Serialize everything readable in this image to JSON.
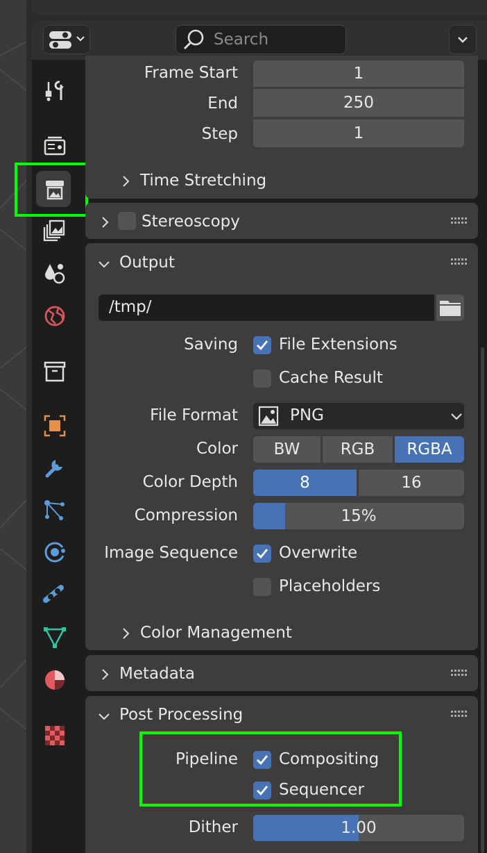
{
  "header": {
    "search_placeholder": "Search"
  },
  "frame_range": {
    "start_label": "Frame Start",
    "start_value": "1",
    "end_label": "End",
    "end_value": "250",
    "step_label": "Step",
    "step_value": "1",
    "time_stretching_label": "Time Stretching"
  },
  "stereoscopy": {
    "label": "Stereoscopy",
    "enabled": false
  },
  "output": {
    "title": "Output",
    "path": "/tmp/",
    "saving_label": "Saving",
    "file_extensions_label": "File Extensions",
    "file_extensions_checked": true,
    "cache_result_label": "Cache Result",
    "cache_result_checked": false,
    "file_format_label": "File Format",
    "file_format_value": "PNG",
    "color_label": "Color",
    "color_options": [
      "BW",
      "RGB",
      "RGBA"
    ],
    "color_selected": "RGBA",
    "color_depth_label": "Color Depth",
    "color_depth_options": [
      "8",
      "16"
    ],
    "color_depth_selected": "8",
    "compression_label": "Compression",
    "compression_value": "15%",
    "compression_fraction": 0.15,
    "image_sequence_label": "Image Sequence",
    "overwrite_label": "Overwrite",
    "overwrite_checked": true,
    "placeholders_label": "Placeholders",
    "placeholders_checked": false,
    "color_management_label": "Color Management"
  },
  "metadata": {
    "title": "Metadata"
  },
  "post_processing": {
    "title": "Post Processing",
    "pipeline_label": "Pipeline",
    "compositing_label": "Compositing",
    "compositing_checked": true,
    "sequencer_label": "Sequencer",
    "sequencer_checked": true,
    "dither_label": "Dither",
    "dither_value": "1.00",
    "dither_fraction": 0.5
  },
  "tabs": [
    "tool-icon",
    "render-icon",
    "output-icon",
    "view-layer-icon",
    "scene-icon",
    "world-icon",
    "collection-icon",
    "object-icon",
    "modifier-icon",
    "particles-icon",
    "physics-icon",
    "constraints-icon",
    "data-icon",
    "material-icon",
    "texture-icon"
  ],
  "colors": {
    "accent": "#4772b3",
    "highlight": "#00ff00",
    "panel": "#3d3d3d",
    "field": "#545454"
  }
}
